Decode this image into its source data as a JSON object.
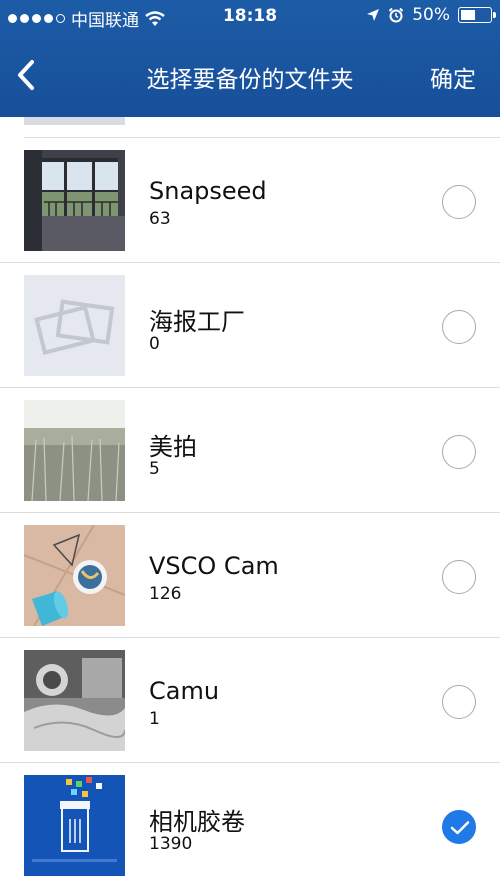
{
  "status_bar": {
    "carrier": "中国联通",
    "time": "18:18",
    "battery": "50%",
    "battery_level": 0.5,
    "signal_dots_filled": 4,
    "icons": [
      "wifi-icon",
      "location-arrow-icon",
      "alarm-icon",
      "battery-icon"
    ]
  },
  "nav": {
    "title": "选择要备份的文件夹",
    "confirm_label": "确定",
    "back_icon": "chevron-left-icon"
  },
  "colors": {
    "header": "#1d5ca7",
    "accent": "#1f7ae8",
    "divider": "#dcdcdc"
  },
  "folders": [
    {
      "name": "Snapseed",
      "count": "63",
      "checked": false,
      "thumb": "balcony-photo"
    },
    {
      "name": "海报工厂",
      "count": "0",
      "checked": false,
      "thumb": "empty-album-icon"
    },
    {
      "name": "美拍",
      "count": "5",
      "checked": false,
      "thumb": "grass-field-photo"
    },
    {
      "name": "VSCO Cam",
      "count": "126",
      "checked": false,
      "thumb": "floor-cup-photo"
    },
    {
      "name": "Camu",
      "count": "1",
      "checked": false,
      "thumb": "bedroom-photo"
    },
    {
      "name": "相机胶卷",
      "count": "1390",
      "checked": true,
      "thumb": "blue-app-screenshot"
    }
  ]
}
